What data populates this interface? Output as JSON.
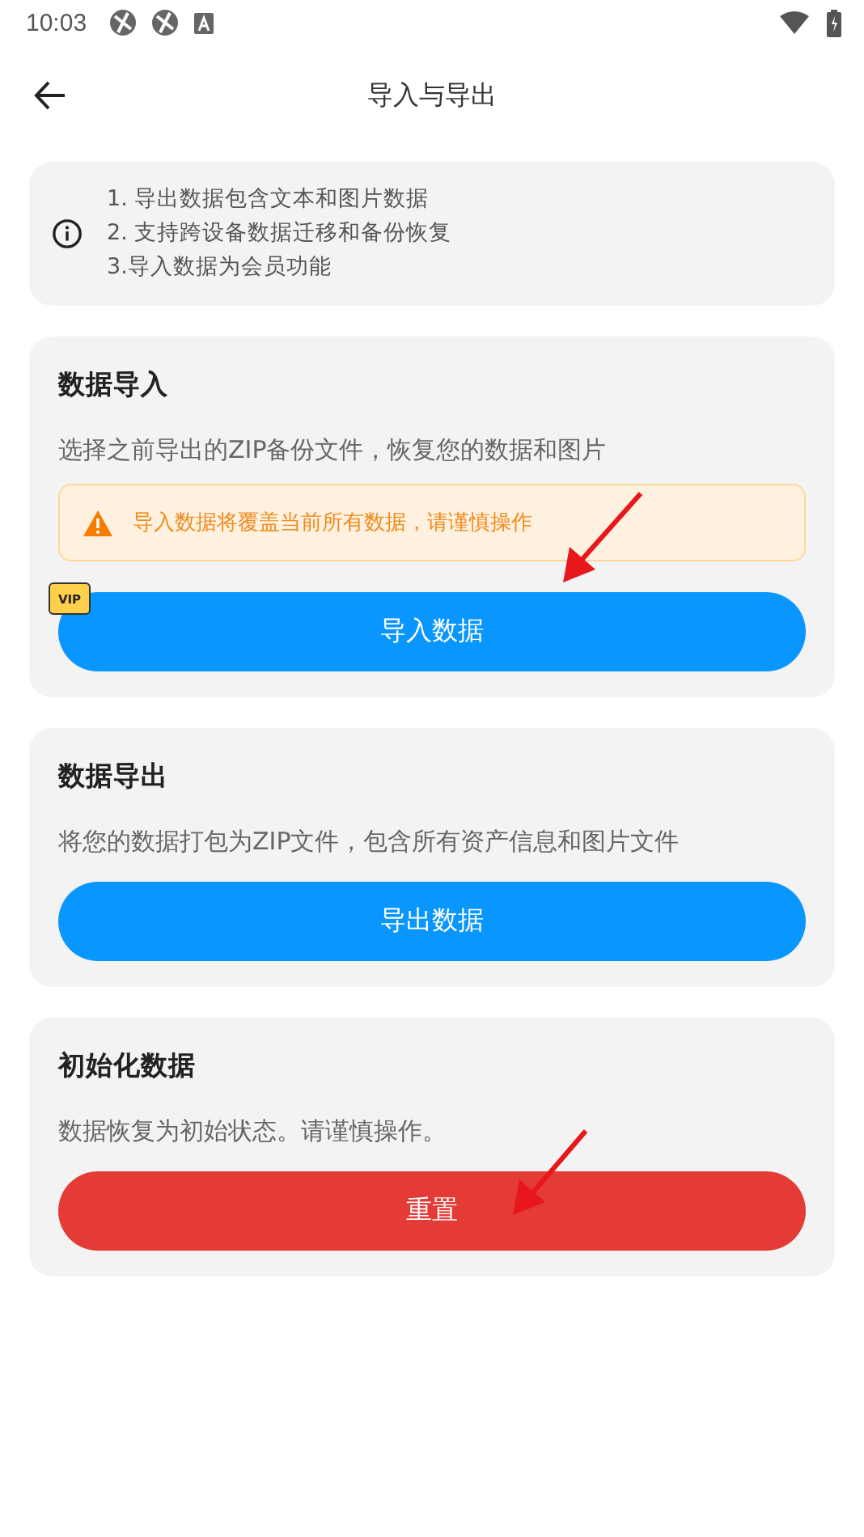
{
  "status_bar": {
    "time": "10:03"
  },
  "app_bar": {
    "title": "导入与导出"
  },
  "info": {
    "lines": [
      "1. 导出数据包含文本和图片数据",
      "2. 支持跨设备数据迁移和备份恢复",
      "3.导入数据为会员功能"
    ]
  },
  "sections": [
    {
      "title": "数据导入",
      "description": "选择之前导出的ZIP备份文件，恢复您的数据和图片",
      "warning": "导入数据将覆盖当前所有数据，请谨慎操作",
      "badge": "VIP",
      "button": {
        "label": "导入数据",
        "kind": "primary"
      }
    },
    {
      "title": "数据导出",
      "description": "将您的数据打包为ZIP文件，包含所有资产信息和图片文件",
      "button": {
        "label": "导出数据",
        "kind": "primary"
      }
    },
    {
      "title": "初始化数据",
      "description": "数据恢复为初始状态。请谨慎操作。",
      "button": {
        "label": "重置",
        "kind": "danger"
      }
    }
  ]
}
